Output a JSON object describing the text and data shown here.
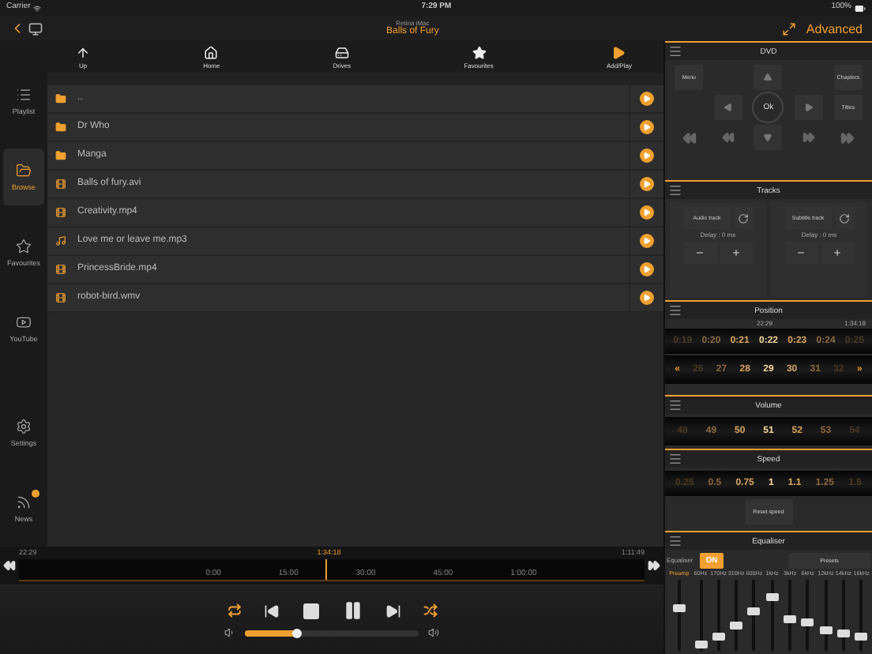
{
  "status_bar": {
    "carrier": "Carrier",
    "time": "7:29 PM",
    "battery": "100%"
  },
  "nav": {
    "subtitle": "Retina iMac",
    "title": "Balls of Fury",
    "advanced": "Advanced"
  },
  "sidebar": [
    {
      "label": "Playlist",
      "kind": "playlist",
      "selected": false,
      "badge": false
    },
    {
      "label": "Browse",
      "kind": "browse",
      "selected": true,
      "badge": false
    },
    {
      "label": "Favourites",
      "kind": "favourites",
      "selected": false,
      "badge": false
    },
    {
      "label": "YouTube",
      "kind": "youtube",
      "selected": false,
      "badge": false
    },
    {
      "label": "Settings",
      "kind": "settings",
      "selected": false,
      "badge": false
    },
    {
      "label": "News",
      "kind": "news",
      "selected": false,
      "badge": true
    }
  ],
  "toolbar": [
    {
      "label": "Up",
      "kind": "up"
    },
    {
      "label": "Home",
      "kind": "home"
    },
    {
      "label": "Drives",
      "kind": "drives"
    },
    {
      "label": "Favourites",
      "kind": "favourites"
    },
    {
      "label": "Add/Play",
      "kind": "addplay"
    }
  ],
  "files": [
    {
      "name": "..",
      "kind": "folder"
    },
    {
      "name": "Dr Who",
      "kind": "folder"
    },
    {
      "name": "Manga",
      "kind": "folder"
    },
    {
      "name": "Balls of fury.avi",
      "kind": "video"
    },
    {
      "name": "Creativity.mp4",
      "kind": "video"
    },
    {
      "name": "Love me or leave me.mp3",
      "kind": "audio"
    },
    {
      "name": "PrincessBride.mp4",
      "kind": "video"
    },
    {
      "name": "robot-bird.wmv",
      "kind": "video"
    }
  ],
  "dvd": {
    "title": "DVD",
    "menu": "Menu",
    "chapters": "Chapters",
    "ok": "Ok",
    "titles": "Titles"
  },
  "tracks": {
    "title": "Tracks",
    "audio": "Audio track",
    "subtitle": "Subtitle track",
    "audio_delay": "Delay : 0 ms",
    "subtitle_delay": "Delay : 0 ms"
  },
  "position": {
    "title": "Position",
    "current": "22:29",
    "total": "1:34:18",
    "minutes": [
      {
        "label": "0:19",
        "selected": false
      },
      {
        "label": "0:20",
        "selected": false
      },
      {
        "label": "0:21",
        "selected": false
      },
      {
        "label": "0:22",
        "selected": true
      },
      {
        "label": "0:23",
        "selected": false
      },
      {
        "label": "0:24",
        "selected": false
      },
      {
        "label": "0:25",
        "selected": false
      }
    ],
    "seconds_prev": "«",
    "seconds_next": "»",
    "seconds": [
      {
        "label": "26",
        "selected": false
      },
      {
        "label": "27",
        "selected": false
      },
      {
        "label": "28",
        "selected": false
      },
      {
        "label": "29",
        "selected": true
      },
      {
        "label": "30",
        "selected": false
      },
      {
        "label": "31",
        "selected": false
      },
      {
        "label": "32",
        "selected": false
      }
    ]
  },
  "volume": {
    "title": "Volume",
    "values": [
      {
        "label": "48",
        "selected": false
      },
      {
        "label": "49",
        "selected": false
      },
      {
        "label": "50",
        "selected": false
      },
      {
        "label": "51",
        "selected": true
      },
      {
        "label": "52",
        "selected": false
      },
      {
        "label": "53",
        "selected": false
      },
      {
        "label": "54",
        "selected": false
      }
    ]
  },
  "speed": {
    "title": "Speed",
    "reset": "Reset speed",
    "values": [
      {
        "label": "0.25",
        "selected": false
      },
      {
        "label": "0.5",
        "selected": false
      },
      {
        "label": "0.75",
        "selected": false
      },
      {
        "label": "1",
        "selected": true
      },
      {
        "label": "1.1",
        "selected": false
      },
      {
        "label": "1.25",
        "selected": false
      },
      {
        "label": "1.5",
        "selected": false
      }
    ]
  },
  "equaliser": {
    "title": "Equaliser",
    "label": "Equaliser",
    "on": true,
    "on_label": "ON",
    "presets": "Presets",
    "preamp": {
      "label": "Preamp",
      "level": 0.6
    },
    "bands": [
      {
        "label": "60Hz",
        "level": 0.1
      },
      {
        "label": "170Hz",
        "level": 0.2
      },
      {
        "label": "310Hz",
        "level": 0.35
      },
      {
        "label": "600Hz",
        "level": 0.55
      },
      {
        "label": "1kHz",
        "level": 0.75
      },
      {
        "label": "3kHz",
        "level": 0.45
      },
      {
        "label": "6kHz",
        "level": 0.4
      },
      {
        "label": "12kHz",
        "level": 0.3
      },
      {
        "label": "14kHz",
        "level": 0.25
      },
      {
        "label": "16kHz",
        "level": 0.2
      }
    ]
  },
  "timeline": {
    "start": "22:29",
    "marker": "1:34:18",
    "end": "1:11:49",
    "level": 0.49,
    "ticks": [
      "0:00",
      "15:00",
      "30:00",
      "45:00",
      "1:00:00"
    ]
  },
  "player": {
    "repeat": true,
    "shuffle": true,
    "volume": {
      "level": 0.3
    }
  }
}
